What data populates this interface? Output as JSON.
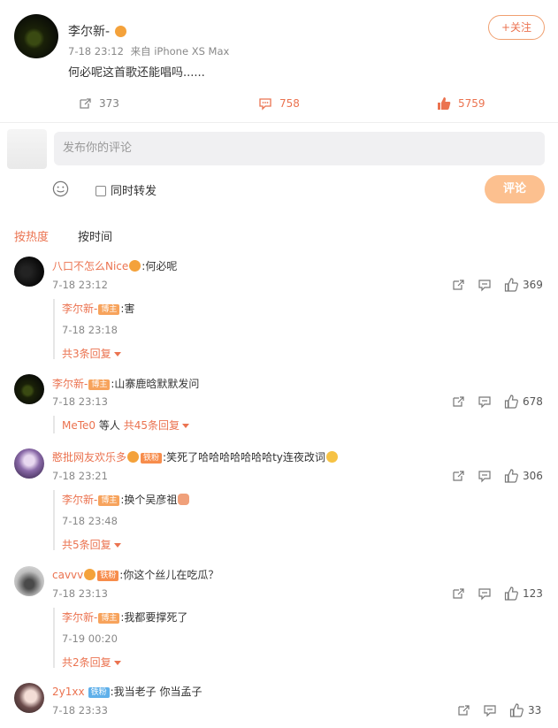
{
  "post": {
    "author": "李尔新-",
    "time": "7-18 23:12",
    "source": "来自 iPhone XS Max",
    "text": "何必呢这首歌还能唱吗......",
    "follow_label": "+关注",
    "repost_count": "373",
    "comment_count": "758",
    "like_count": "5759"
  },
  "composer": {
    "placeholder": "发布你的评论",
    "also_repost_label": "同时转发",
    "submit_label": "评论"
  },
  "sort": {
    "hot_label": "按热度",
    "time_label": "按时间"
  },
  "comments": [
    {
      "user": "八口不怎么Nice",
      "text": ":何必呢",
      "time": "7-18 23:12",
      "likes": "369",
      "reply": {
        "user": "李尔新-",
        "badge": "博主",
        "text": ":害",
        "time": "7-18 23:18"
      },
      "more": "共3条回复"
    },
    {
      "user": "李尔新-",
      "badge": "博主",
      "text": ":山寨鹿晗默默发问",
      "time": "7-18 23:13",
      "likes": "678",
      "more_user": "MeTe0",
      "more_mid": " 等人 ",
      "more": "共45条回复"
    },
    {
      "user": "憨批网友欢乐多",
      "badge": "铁粉",
      "text": ":笑死了哈哈哈哈哈哈哈ty连夜改词",
      "time": "7-18 23:21",
      "likes": "306",
      "reply": {
        "user": "李尔新-",
        "badge": "博主",
        "text": ":换个吴彦祖",
        "time": "7-18 23:48"
      },
      "more": "共5条回复"
    },
    {
      "user": "cavvv",
      "badge": "铁粉",
      "text": ":你这个丝儿在吃瓜？",
      "time": "7-18 23:13",
      "likes": "123",
      "reply": {
        "user": "李尔新-",
        "badge": "博主",
        "text": ":我都要撑死了",
        "time": "7-19 00:20"
      },
      "more": "共2条回复"
    },
    {
      "user": "2y1xx",
      "badge": "铁粉",
      "text": ":我当老子 你当孟子",
      "time": "7-18 23:33",
      "likes": "33"
    }
  ],
  "colors": {
    "accent": "#eb7350",
    "submit": "#fcc08f",
    "badge": "#f7a35c",
    "badge_tie": "#5fb0ea"
  }
}
